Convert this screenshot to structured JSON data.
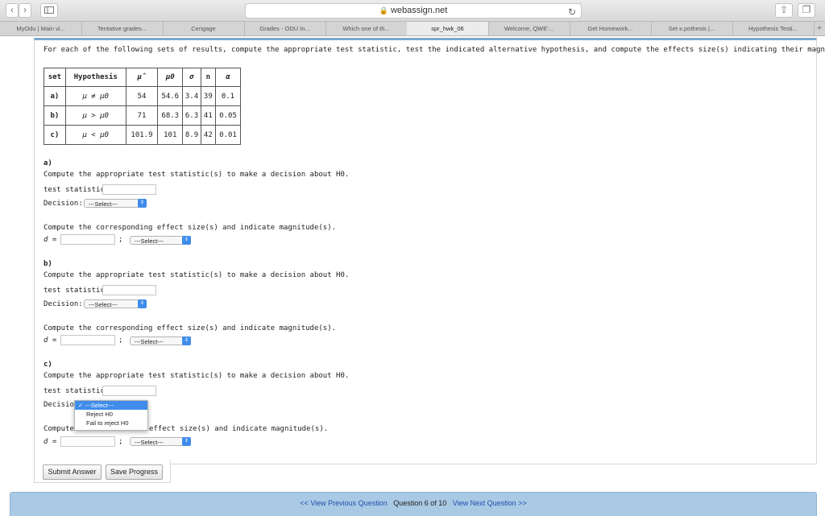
{
  "browser": {
    "url": "webassign.net",
    "tabs": [
      {
        "label": "MyOdu | Main vi..."
      },
      {
        "label": "Tentative grades..."
      },
      {
        "label": "Cengage"
      },
      {
        "label": "Grades - ODU In..."
      },
      {
        "label": "Which one of th..."
      },
      {
        "label": "spr_hwk_06"
      },
      {
        "label": "Welcome, QWE'..."
      },
      {
        "label": "Get Homework..."
      },
      {
        "label": "Set κ.pothesis |..."
      },
      {
        "label": "Hypothesis Testi..."
      }
    ],
    "new_tab": "+"
  },
  "instructions": "For each of the following sets of results, compute the appropriate test statistic, test the indicated alternative hypothesis, and compute the effects size(s) indicating their magnitude:",
  "table": {
    "headers": [
      "set",
      "Hypothesis",
      "μ̂",
      "μ0",
      "σ",
      "n",
      "α"
    ],
    "rows": [
      [
        "a)",
        "μ ≠ μ0",
        "54",
        "54.6",
        "3.4",
        "39",
        "0.1"
      ],
      [
        "b)",
        "μ > μ0",
        "71",
        "68.3",
        "6.3",
        "41",
        "0.05"
      ],
      [
        "c)",
        "μ < μ0",
        "101.9",
        "101",
        "8.9",
        "42",
        "0.01"
      ]
    ]
  },
  "parts": [
    {
      "label": "a)",
      "compute_stat": "Compute the appropriate test statistic(s) to make a decision about H0.",
      "stat_label": "test statistic =",
      "decision_label": "Decision:",
      "decision_select": "---Select---",
      "effect_prompt": "Compute the corresponding effect size(s) and indicate magnitude(s).",
      "d_label": "d =",
      "semicolon": ";",
      "mag_select": "---Select---"
    },
    {
      "label": "b)",
      "compute_stat": "Compute the appropriate test statistic(s) to make a decision about H0.",
      "stat_label": "test statistic =",
      "decision_label": "Decision:",
      "decision_select": "---Select---",
      "effect_prompt": "Compute the corresponding effect size(s) and indicate magnitude(s).",
      "d_label": "d =",
      "semicolon": ";",
      "mag_select": "---Select---"
    },
    {
      "label": "c)",
      "compute_stat": "Compute the appropriate test statistic(s) to make a decision about H0.",
      "stat_label": "test statistic =",
      "decision_label": "Decision",
      "effect_prompt_visible": "effect size(s) and indicate magnitude(s).",
      "compute_prefix": "Compute",
      "d_label": "d =",
      "semicolon": ";",
      "mag_select": "---Select---"
    }
  ],
  "dropdown": {
    "options": [
      "---Select---",
      "Reject H0",
      "Fail to reject H0"
    ],
    "checkmark": "✓"
  },
  "buttons": {
    "submit": "Submit Answer",
    "save": "Save Progress"
  },
  "footer": {
    "prev": "<< View Previous Question",
    "position": "Question 6 of 10",
    "next": "View Next Question >>"
  },
  "colors": {
    "accent": "#3f8ceb",
    "footer_bg": "#a9c9e4",
    "link": "#1f4fb0"
  }
}
